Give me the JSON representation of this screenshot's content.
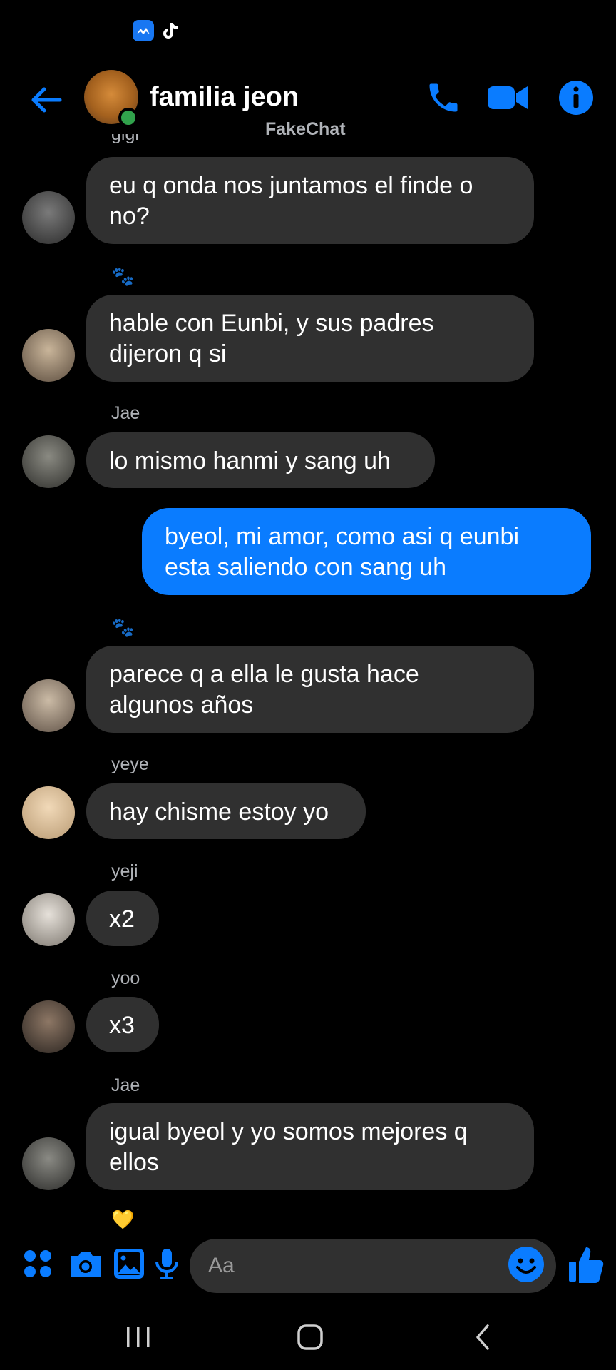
{
  "header": {
    "title": "familia jeon",
    "watermark": "FakeChat",
    "cut_label": "gigi"
  },
  "messages": [
    {
      "sender": "",
      "text": "eu q onda nos juntamos el finde o\nno?",
      "from_me": false,
      "avatar": "avatar-1"
    },
    {
      "sender": "",
      "text": "hable con Eunbi, y sus padres\ndijeron q si",
      "from_me": false,
      "avatar": "avatar-2"
    },
    {
      "sender": "Jae",
      "text": "lo mismo hanmi y sang uh",
      "from_me": false,
      "avatar": "avatar-3"
    },
    {
      "sender": "",
      "text": "byeol, mi amor, como asi q eunbi\nesta saliendo con sang uh",
      "from_me": true
    },
    {
      "sender": "",
      "text": "parece q a ella le gusta hace\nalgunos años",
      "from_me": false,
      "avatar": "avatar-4"
    },
    {
      "sender": "yeye",
      "text": "hay chisme estoy yo",
      "from_me": false,
      "avatar": "avatar-5"
    },
    {
      "sender": "yeji",
      "text": "x2",
      "from_me": false,
      "avatar": "avatar-6"
    },
    {
      "sender": "yoo",
      "text": "x3",
      "from_me": false,
      "avatar": "avatar-7"
    },
    {
      "sender": "Jae",
      "text": "igual byeol y yo somos mejores q\nellos",
      "from_me": false,
      "avatar": "avatar-8"
    }
  ],
  "reactions": {
    "paw": "🐾",
    "heart": "💛"
  },
  "composer": {
    "placeholder": "Aa"
  },
  "colors": {
    "accent": "#0a7cff",
    "bubble_other": "#303030",
    "background": "#000000",
    "online": "#31a24c"
  },
  "icons": [
    "back-arrow-icon",
    "phone-icon",
    "video-camera-icon",
    "info-icon",
    "apps-icon",
    "camera-icon",
    "gallery-icon",
    "microphone-icon",
    "emoji-icon",
    "thumbs-up-icon",
    "recent-apps-icon",
    "home-icon",
    "nav-back-icon"
  ]
}
